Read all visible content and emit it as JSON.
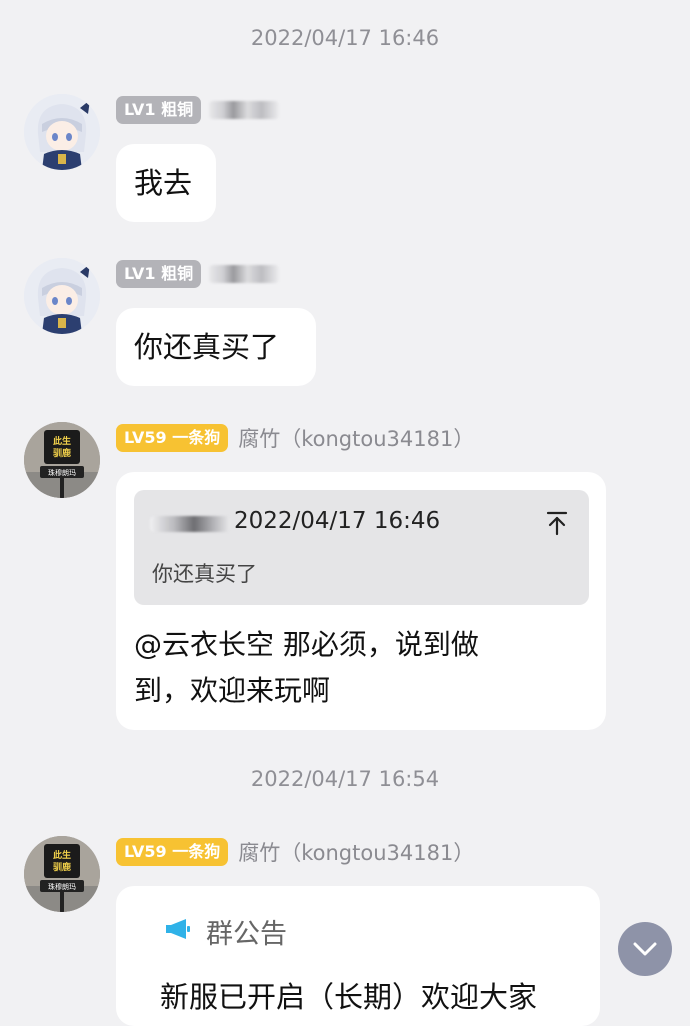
{
  "timestamps": [
    "2022/04/17 16:46",
    "2022/04/17 16:54"
  ],
  "messages": [
    {
      "level_badge": "LV1 粗铜",
      "text": "我去"
    },
    {
      "level_badge": "LV1 粗铜",
      "text": "你还真买了"
    },
    {
      "level_badge": "LV59 一条狗",
      "username": "腐竹（kongtou34181）",
      "quote": {
        "time": "2022/04/17 16:46",
        "text": "你还真买了"
      },
      "text_line1": "@云衣长空 那必须，说到做",
      "text_line2": "到，欢迎来玩啊"
    },
    {
      "level_badge": "LV59 一条狗",
      "username": "腐竹（kongtou34181）",
      "notice_title": "群公告",
      "notice_text": "新服已开启（长期）欢迎大家"
    }
  ],
  "avatar_texts": {
    "sign_top": "此生",
    "sign_mid": "驯鹿",
    "sign_bottom": "珠穆朗玛"
  },
  "colors": {
    "background": "#f1f1f3",
    "bubble": "#ffffff",
    "badge_gray": "#b3b3b8",
    "badge_gold": "#f7c232",
    "notice_icon": "#2fb2e8",
    "scroll_button": "#8e93a8"
  },
  "icons": [
    "jump-to-original-icon",
    "megaphone-icon",
    "chevron-down-icon"
  ]
}
